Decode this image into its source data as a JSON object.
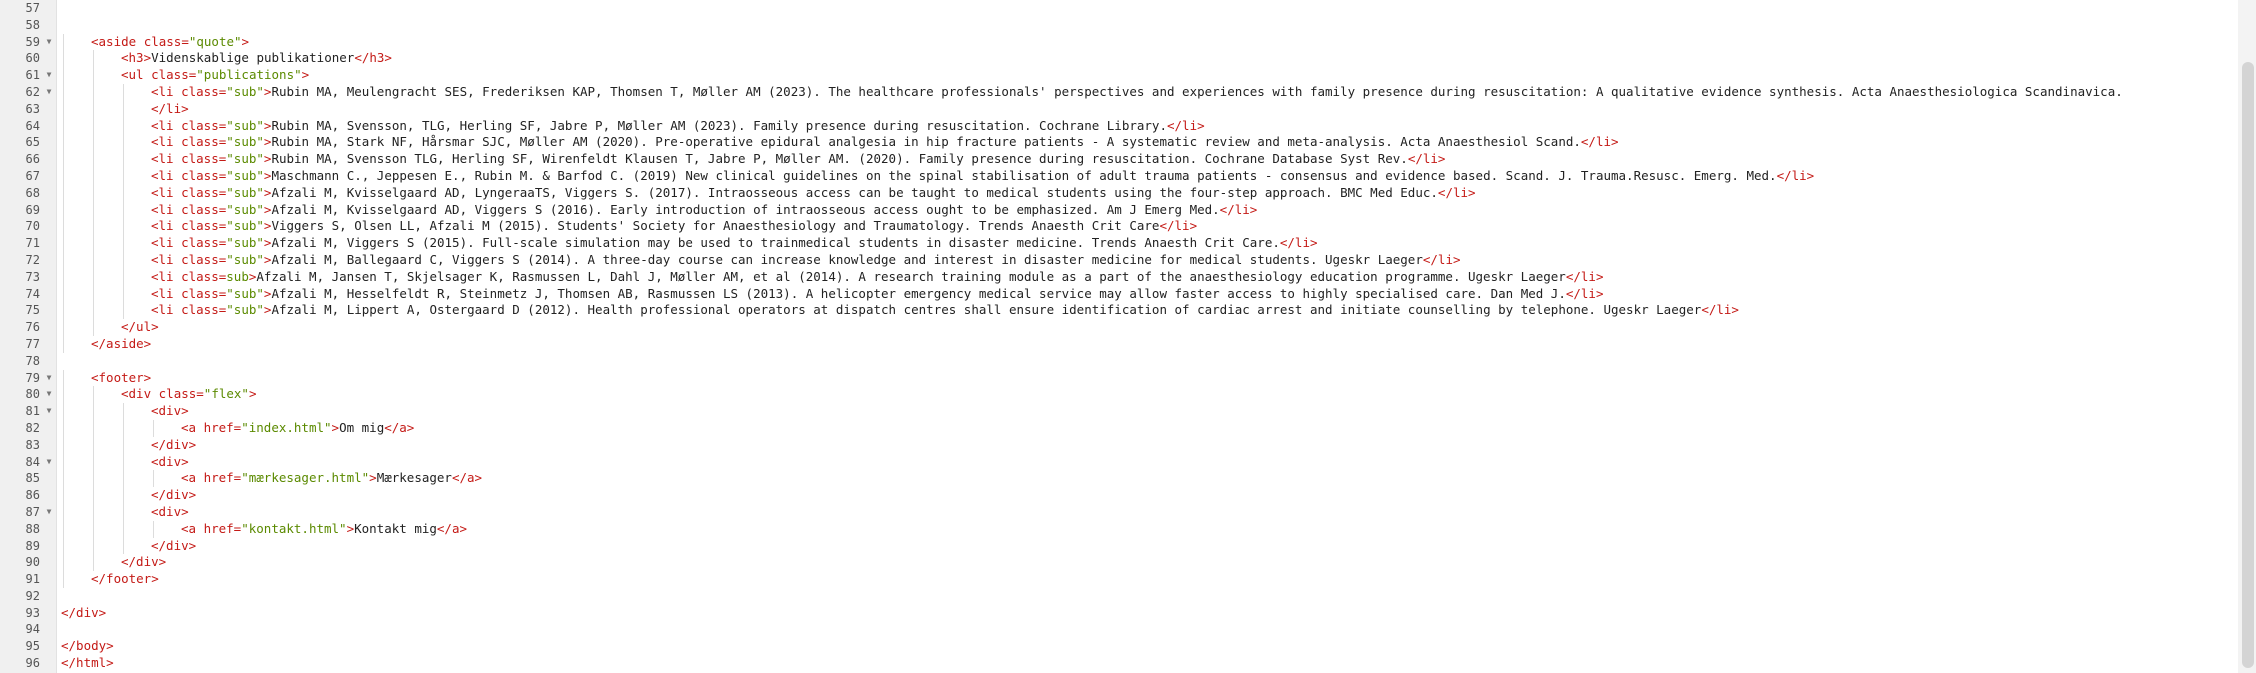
{
  "editor": {
    "lines": [
      {
        "num": "57",
        "fold": false,
        "indent": 0,
        "parts": []
      },
      {
        "num": "58",
        "fold": false,
        "indent": 0,
        "parts": []
      },
      {
        "num": "59",
        "fold": true,
        "indent": 1,
        "parts": [
          {
            "t": "tag",
            "v": "<aside "
          },
          {
            "t": "attr",
            "v": "class="
          },
          {
            "t": "val",
            "v": "\"quote\""
          },
          {
            "t": "tag",
            "v": ">"
          }
        ]
      },
      {
        "num": "60",
        "fold": false,
        "indent": 2,
        "parts": [
          {
            "t": "tag",
            "v": "<h3>"
          },
          {
            "t": "txt",
            "v": "Videnskablige publikationer"
          },
          {
            "t": "tag",
            "v": "</h3>"
          }
        ]
      },
      {
        "num": "61",
        "fold": true,
        "indent": 2,
        "parts": [
          {
            "t": "tag",
            "v": "<ul "
          },
          {
            "t": "attr",
            "v": "class="
          },
          {
            "t": "val",
            "v": "\"publications\""
          },
          {
            "t": "tag",
            "v": ">"
          }
        ]
      },
      {
        "num": "62",
        "fold": true,
        "indent": 3,
        "parts": [
          {
            "t": "tag",
            "v": "<li "
          },
          {
            "t": "attr",
            "v": "class="
          },
          {
            "t": "val",
            "v": "\"sub\""
          },
          {
            "t": "tag",
            "v": ">"
          },
          {
            "t": "txt",
            "v": "Rubin MA, Meulengracht SES, Frederiksen KAP, Thomsen T, Møller AM (2023). The healthcare professionals' perspectives and experiences with family presence during resuscitation: A qualitative evidence synthesis. Acta Anaesthesiologica Scandinavica."
          }
        ]
      },
      {
        "num": "63",
        "fold": false,
        "indent": 3,
        "parts": [
          {
            "t": "tag",
            "v": "</li>"
          }
        ]
      },
      {
        "num": "64",
        "fold": false,
        "indent": 3,
        "parts": [
          {
            "t": "tag",
            "v": "<li "
          },
          {
            "t": "attr",
            "v": "class="
          },
          {
            "t": "val",
            "v": "\"sub\""
          },
          {
            "t": "tag",
            "v": ">"
          },
          {
            "t": "txt",
            "v": "Rubin MA, Svensson, TLG, Herling SF, Jabre P, Møller AM (2023). Family presence during resuscitation. Cochrane Library."
          },
          {
            "t": "tag",
            "v": "</li>"
          }
        ]
      },
      {
        "num": "65",
        "fold": false,
        "indent": 3,
        "parts": [
          {
            "t": "tag",
            "v": "<li "
          },
          {
            "t": "attr",
            "v": "class="
          },
          {
            "t": "val",
            "v": "\"sub\""
          },
          {
            "t": "tag",
            "v": ">"
          },
          {
            "t": "txt",
            "v": "Rubin MA, Stark NF, Hårsmar SJC, Møller AM (2020). Pre-operative epidural analgesia in hip fracture patients - A systematic review and meta-analysis. Acta Anaesthesiol Scand."
          },
          {
            "t": "tag",
            "v": "</li>"
          }
        ]
      },
      {
        "num": "66",
        "fold": false,
        "indent": 3,
        "parts": [
          {
            "t": "tag",
            "v": "<li "
          },
          {
            "t": "attr",
            "v": "class="
          },
          {
            "t": "val",
            "v": "\"sub\""
          },
          {
            "t": "tag",
            "v": ">"
          },
          {
            "t": "txt",
            "v": "Rubin MA, Svensson TLG, Herling SF, Wirenfeldt Klausen T, Jabre P, Møller AM. (2020). Family presence during resuscitation. Cochrane Database Syst Rev."
          },
          {
            "t": "tag",
            "v": "</li>"
          }
        ]
      },
      {
        "num": "67",
        "fold": false,
        "indent": 3,
        "parts": [
          {
            "t": "tag",
            "v": "<li "
          },
          {
            "t": "attr",
            "v": "class="
          },
          {
            "t": "val",
            "v": "\"sub\""
          },
          {
            "t": "tag",
            "v": ">"
          },
          {
            "t": "txt",
            "v": "Maschmann C., Jeppesen E., Rubin M. & Barfod C. (2019) New clinical guidelines on the spinal stabilisation of adult trauma patients - consensus and evidence based. Scand. J. Trauma.Resusc. Emerg. Med."
          },
          {
            "t": "tag",
            "v": "</li>"
          }
        ]
      },
      {
        "num": "68",
        "fold": false,
        "indent": 3,
        "parts": [
          {
            "t": "tag",
            "v": "<li "
          },
          {
            "t": "attr",
            "v": "class="
          },
          {
            "t": "val",
            "v": "\"sub\""
          },
          {
            "t": "tag",
            "v": ">"
          },
          {
            "t": "txt",
            "v": "Afzali M, Kvisselgaard AD, LyngeraaTS, Viggers S. (2017). Intraosseous access can be taught to medical students using the four-step approach. BMC Med Educ."
          },
          {
            "t": "tag",
            "v": "</li>"
          }
        ]
      },
      {
        "num": "69",
        "fold": false,
        "indent": 3,
        "parts": [
          {
            "t": "tag",
            "v": "<li "
          },
          {
            "t": "attr",
            "v": "class="
          },
          {
            "t": "val",
            "v": "\"sub\""
          },
          {
            "t": "tag",
            "v": ">"
          },
          {
            "t": "txt",
            "v": "Afzali M, Kvisselgaard AD, Viggers S (2016). Early introduction of intraosseous access ought to be emphasized. Am J Emerg Med."
          },
          {
            "t": "tag",
            "v": "</li>"
          }
        ]
      },
      {
        "num": "70",
        "fold": false,
        "indent": 3,
        "parts": [
          {
            "t": "tag",
            "v": "<li "
          },
          {
            "t": "attr",
            "v": "class="
          },
          {
            "t": "val",
            "v": "\"sub\""
          },
          {
            "t": "tag",
            "v": ">"
          },
          {
            "t": "txt",
            "v": "Viggers S, Olsen LL, Afzali M (2015). Students' Society for Anaesthesiology and Traumatology. Trends Anaesth Crit Care"
          },
          {
            "t": "tag",
            "v": "</li>"
          }
        ]
      },
      {
        "num": "71",
        "fold": false,
        "indent": 3,
        "parts": [
          {
            "t": "tag",
            "v": "<li "
          },
          {
            "t": "attr",
            "v": "class="
          },
          {
            "t": "val",
            "v": "\"sub\""
          },
          {
            "t": "tag",
            "v": ">"
          },
          {
            "t": "txt",
            "v": "Afzali M, Viggers S (2015). Full-scale simulation may be used to trainmedical students in disaster medicine. Trends Anaesth Crit Care."
          },
          {
            "t": "tag",
            "v": "</li>"
          }
        ]
      },
      {
        "num": "72",
        "fold": false,
        "indent": 3,
        "parts": [
          {
            "t": "tag",
            "v": "<li "
          },
          {
            "t": "attr",
            "v": "class="
          },
          {
            "t": "val",
            "v": "\"sub\""
          },
          {
            "t": "tag",
            "v": ">"
          },
          {
            "t": "txt",
            "v": "Afzali M, Ballegaard C, Viggers S (2014). A three-day course can increase knowledge and interest in disaster medicine for medical students. Ugeskr Laeger"
          },
          {
            "t": "tag",
            "v": "</li>"
          }
        ]
      },
      {
        "num": "73",
        "fold": false,
        "indent": 3,
        "parts": [
          {
            "t": "tag",
            "v": "<li "
          },
          {
            "t": "attr",
            "v": "class="
          },
          {
            "t": "val",
            "v": "sub"
          },
          {
            "t": "tag",
            "v": ">"
          },
          {
            "t": "txt",
            "v": "Afzali M, Jansen T, Skjelsager K, Rasmussen L, Dahl J, Møller AM, et al (2014). A research training module as a part of the anaesthesiology education programme. Ugeskr Laeger"
          },
          {
            "t": "tag",
            "v": "</li>"
          }
        ]
      },
      {
        "num": "74",
        "fold": false,
        "indent": 3,
        "parts": [
          {
            "t": "tag",
            "v": "<li "
          },
          {
            "t": "attr",
            "v": "class="
          },
          {
            "t": "val",
            "v": "\"sub\""
          },
          {
            "t": "tag",
            "v": ">"
          },
          {
            "t": "txt",
            "v": "Afzali M, Hesselfeldt R, Steinmetz J, Thomsen AB, Rasmussen LS (2013). A helicopter emergency medical service may allow faster access to highly specialised care. Dan Med J."
          },
          {
            "t": "tag",
            "v": "</li>"
          }
        ]
      },
      {
        "num": "75",
        "fold": false,
        "indent": 3,
        "parts": [
          {
            "t": "tag",
            "v": "<li "
          },
          {
            "t": "attr",
            "v": "class="
          },
          {
            "t": "val",
            "v": "\"sub\""
          },
          {
            "t": "tag",
            "v": ">"
          },
          {
            "t": "txt",
            "v": "Afzali M, Lippert A, Ostergaard D (2012). Health professional operators at dispatch centres shall ensure identification of cardiac arrest and initiate counselling by telephone. Ugeskr Laeger"
          },
          {
            "t": "tag",
            "v": "</li>"
          }
        ]
      },
      {
        "num": "76",
        "fold": false,
        "indent": 2,
        "parts": [
          {
            "t": "tag",
            "v": "</ul>"
          }
        ]
      },
      {
        "num": "77",
        "fold": false,
        "indent": 1,
        "parts": [
          {
            "t": "tag",
            "v": "</aside>"
          }
        ]
      },
      {
        "num": "78",
        "fold": false,
        "indent": 0,
        "parts": []
      },
      {
        "num": "79",
        "fold": true,
        "indent": 1,
        "parts": [
          {
            "t": "tag",
            "v": "<footer>"
          }
        ]
      },
      {
        "num": "80",
        "fold": true,
        "indent": 2,
        "parts": [
          {
            "t": "tag",
            "v": "<div "
          },
          {
            "t": "attr",
            "v": "class="
          },
          {
            "t": "val",
            "v": "\"flex\""
          },
          {
            "t": "tag",
            "v": ">"
          }
        ]
      },
      {
        "num": "81",
        "fold": true,
        "indent": 3,
        "parts": [
          {
            "t": "tag",
            "v": "<div>"
          }
        ]
      },
      {
        "num": "82",
        "fold": false,
        "indent": 4,
        "parts": [
          {
            "t": "tag",
            "v": "<a "
          },
          {
            "t": "attr",
            "v": "href="
          },
          {
            "t": "val",
            "v": "\"index.html\""
          },
          {
            "t": "tag",
            "v": ">"
          },
          {
            "t": "txt",
            "v": "Om mig"
          },
          {
            "t": "tag",
            "v": "</a>"
          }
        ]
      },
      {
        "num": "83",
        "fold": false,
        "indent": 3,
        "parts": [
          {
            "t": "tag",
            "v": "</div>"
          }
        ]
      },
      {
        "num": "84",
        "fold": true,
        "indent": 3,
        "parts": [
          {
            "t": "tag",
            "v": "<div>"
          }
        ]
      },
      {
        "num": "85",
        "fold": false,
        "indent": 4,
        "parts": [
          {
            "t": "tag",
            "v": "<a "
          },
          {
            "t": "attr",
            "v": "href="
          },
          {
            "t": "val",
            "v": "\"mærkesager.html\""
          },
          {
            "t": "tag",
            "v": ">"
          },
          {
            "t": "txt",
            "v": "Mærkesager"
          },
          {
            "t": "tag",
            "v": "</a>"
          }
        ]
      },
      {
        "num": "86",
        "fold": false,
        "indent": 3,
        "parts": [
          {
            "t": "tag",
            "v": "</div>"
          }
        ]
      },
      {
        "num": "87",
        "fold": true,
        "indent": 3,
        "parts": [
          {
            "t": "tag",
            "v": "<div>"
          }
        ]
      },
      {
        "num": "88",
        "fold": false,
        "indent": 4,
        "parts": [
          {
            "t": "tag",
            "v": "<a "
          },
          {
            "t": "attr",
            "v": "href="
          },
          {
            "t": "val",
            "v": "\"kontakt.html\""
          },
          {
            "t": "tag",
            "v": ">"
          },
          {
            "t": "txt",
            "v": "Kontakt mig"
          },
          {
            "t": "tag",
            "v": "</a>"
          }
        ]
      },
      {
        "num": "89",
        "fold": false,
        "indent": 3,
        "parts": [
          {
            "t": "tag",
            "v": "</div>"
          }
        ]
      },
      {
        "num": "90",
        "fold": false,
        "indent": 2,
        "parts": [
          {
            "t": "tag",
            "v": "</div>"
          }
        ]
      },
      {
        "num": "91",
        "fold": false,
        "indent": 1,
        "parts": [
          {
            "t": "tag",
            "v": "</footer>"
          }
        ]
      },
      {
        "num": "92",
        "fold": false,
        "indent": 0,
        "parts": []
      },
      {
        "num": "93",
        "fold": false,
        "indent": 0,
        "parts": [
          {
            "t": "tag",
            "v": "</div>"
          }
        ]
      },
      {
        "num": "94",
        "fold": false,
        "indent": 0,
        "parts": []
      },
      {
        "num": "95",
        "fold": false,
        "indent": 0,
        "parts": [
          {
            "t": "tag",
            "v": "</body>"
          }
        ]
      },
      {
        "num": "96",
        "fold": false,
        "indent": 0,
        "parts": [
          {
            "t": "tag",
            "v": "</html>"
          }
        ]
      }
    ]
  },
  "icons": {
    "fold": "chevron-down-icon"
  },
  "colors": {
    "tag": "#c41a16",
    "value": "#5b8a00",
    "text": "#222222",
    "line_number": "#555555"
  }
}
